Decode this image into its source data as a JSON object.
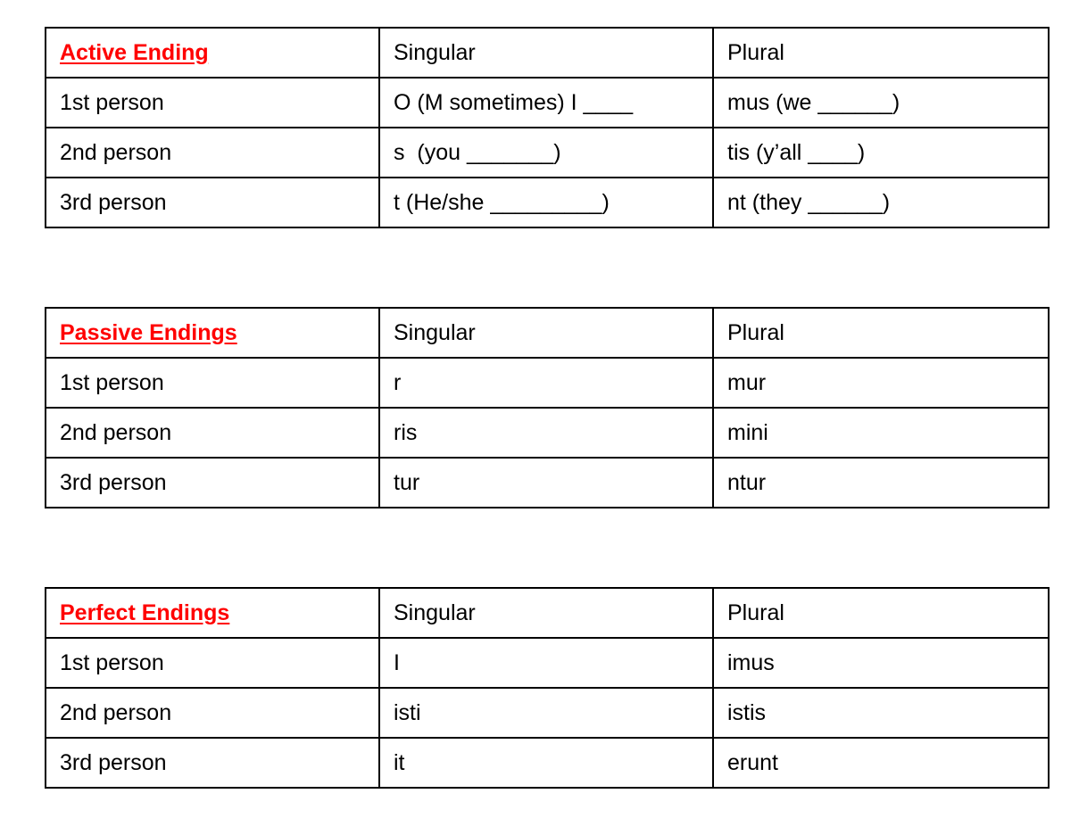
{
  "tables": [
    {
      "title": "Active Ending",
      "title_color": "#ff0000",
      "col_singular": "Singular",
      "col_plural": "Plural",
      "rows": [
        {
          "person": "1st person",
          "singular": "O (M sometimes) I ____",
          "plural": "mus (we ______)"
        },
        {
          "person": "2nd person",
          "singular": "s  (you _______)",
          "plural": "tis (y’all ____)"
        },
        {
          "person": "3rd person",
          "singular": "t (He/she _________)",
          "plural": "nt (they ______)"
        }
      ]
    },
    {
      "title": "Passive Endings",
      "title_color": "#ff0000",
      "col_singular": "Singular",
      "col_plural": "Plural",
      "rows": [
        {
          "person": "1st person",
          "singular": "r",
          "plural": "mur"
        },
        {
          "person": "2nd person",
          "singular": "ris",
          "plural": "mini"
        },
        {
          "person": "3rd person",
          "singular": "tur",
          "plural": "ntur"
        }
      ]
    },
    {
      "title": "Perfect Endings",
      "title_color": "#ff0000",
      "col_singular": "Singular",
      "col_plural": "Plural",
      "rows": [
        {
          "person": "1st person",
          "singular": "I",
          "plural": "imus"
        },
        {
          "person": "2nd person",
          "singular": "isti",
          "plural": "istis"
        },
        {
          "person": "3rd person",
          "singular": "it",
          "plural": "erunt"
        }
      ]
    }
  ]
}
